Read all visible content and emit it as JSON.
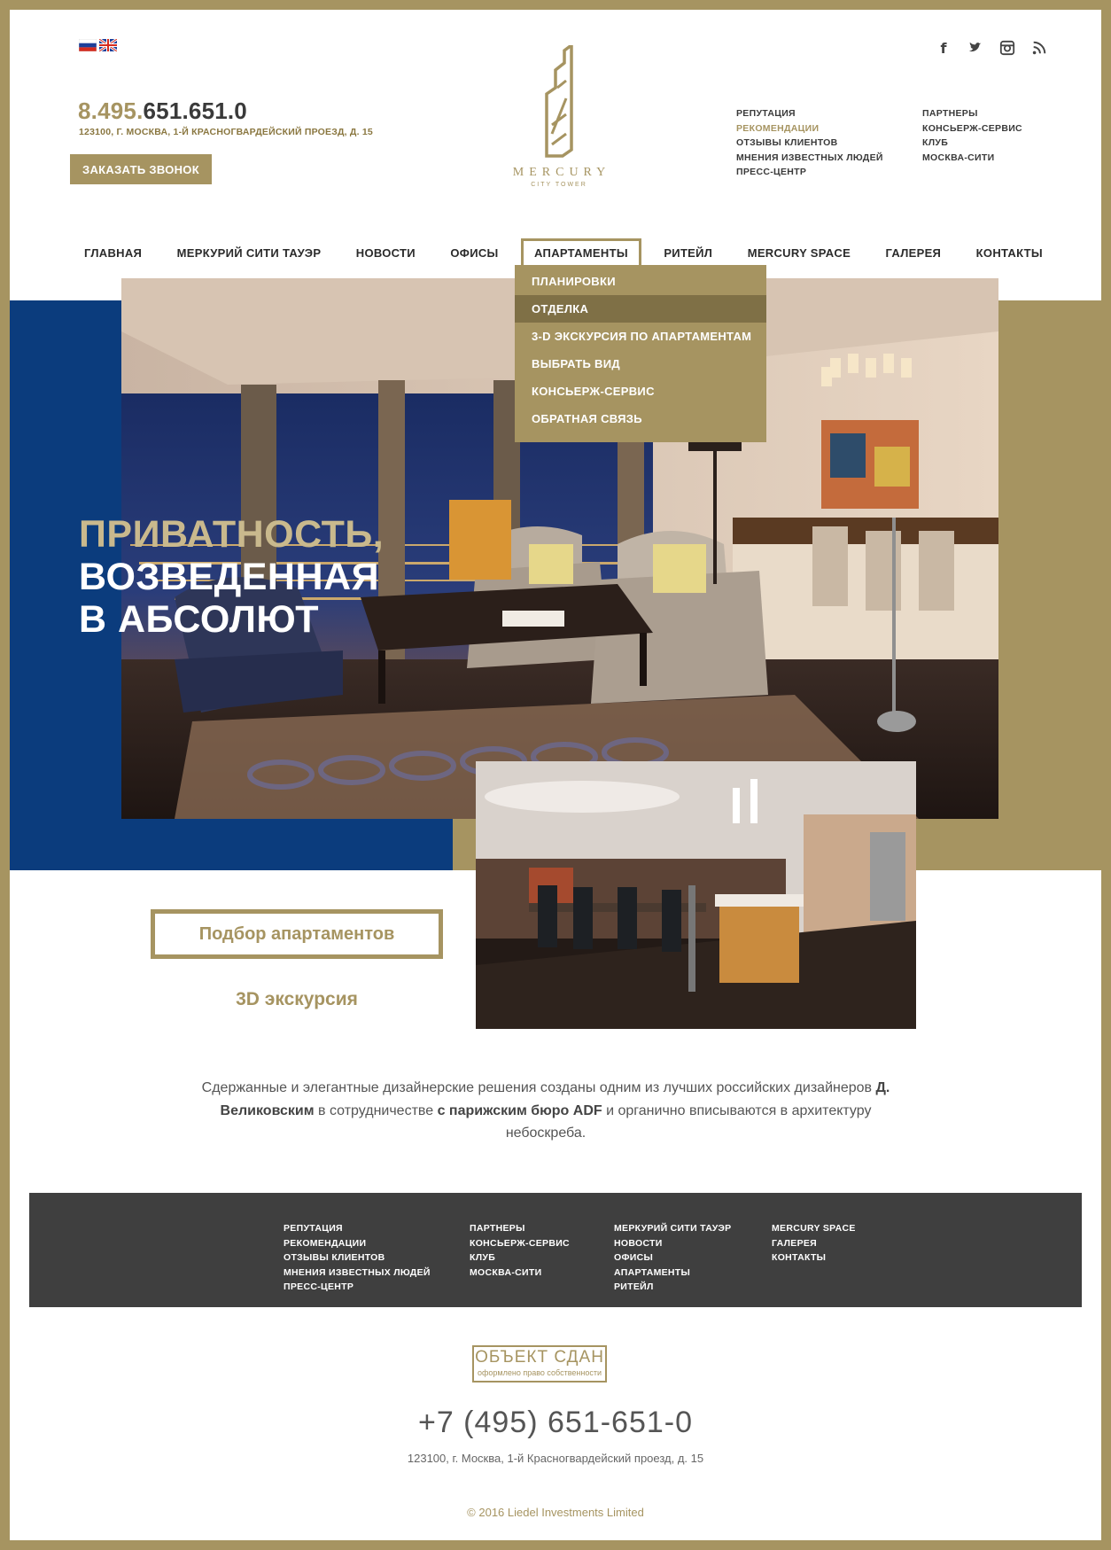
{
  "header": {
    "lang_flags": [
      "ru-flag-icon",
      "uk-flag-icon"
    ],
    "phone_prefix": "8.495.",
    "phone_rest": "651.651.0",
    "address": "123100, Г. МОСКВА, 1-Й КРАСНОГВАРДЕЙСКИЙ ПРОЕЗД, Д. 15",
    "callback_label": "ЗАКАЗАТЬ ЗВОНОК",
    "logo_word": "MERCURY",
    "logo_sub": "CITY TOWER",
    "social": [
      "facebook-icon",
      "twitter-icon",
      "instagram-icon",
      "rss-icon"
    ],
    "links_col1": [
      "РЕПУТАЦИЯ",
      "РЕКОМЕНДАЦИИ",
      "ОТЗЫВЫ КЛИЕНТОВ",
      "МНЕНИЯ ИЗВЕСТНЫХ ЛЮДЕЙ",
      "ПРЕСС-ЦЕНТР"
    ],
    "links_col2": [
      "ПАРТНЕРЫ",
      "КОНСЬЕРЖ-СЕРВИС",
      "КЛУБ",
      "МОСКВА-СИТИ"
    ]
  },
  "nav": {
    "items": [
      "ГЛАВНАЯ",
      "МЕРКУРИЙ СИТИ ТАУЭР",
      "НОВОСТИ",
      "ОФИСЫ",
      "АПАРТАМЕНТЫ",
      "РИТЕЙЛ",
      "MERCURY SPACE",
      "ГАЛЕРЕЯ",
      "КОНТАКТЫ"
    ],
    "active_index": 4
  },
  "dropdown": {
    "items": [
      "ПЛАНИРОВКИ",
      "ОТДЕЛКА",
      "3-D ЭКСКУРСИЯ ПО АПАРТАМЕНТАМ",
      "ВЫБРАТЬ ВИД",
      "КОНСЬЕРЖ-СЕРВИС",
      "ОБРАТНАЯ СВЯЗЬ"
    ],
    "active_index": 1
  },
  "hero": {
    "line1": "ПРИВАТНОСТЬ,",
    "line2": "ВОЗВЕДЕННАЯ",
    "line3": "В АБСОЛЮТ"
  },
  "main": {
    "select_button": "Подбор апартаментов",
    "tour_link": "3D экскурсия",
    "desc_1": "Сдержанные и элегантные дизайнерские решения созданы одним из лучших российских дизайнеров ",
    "desc_b1": "Д. Великовским",
    "desc_2": " в сотрудничестве ",
    "desc_b2": "с парижским бюро ADF",
    "desc_3": " и органично вписываются в архитектуру небоскреба."
  },
  "footer": {
    "col1": [
      "РЕПУТАЦИЯ",
      "РЕКОМЕНДАЦИИ",
      "ОТЗЫВЫ КЛИЕНТОВ",
      "МНЕНИЯ ИЗВЕСТНЫХ ЛЮДЕЙ",
      "ПРЕСС-ЦЕНТР"
    ],
    "col2": [
      "ПАРТНЕРЫ",
      "КОНСЬЕРЖ-СЕРВИС",
      "КЛУБ",
      "МОСКВА-СИТИ"
    ],
    "col3": [
      "МЕРКУРИЙ СИТИ ТАУЭР",
      "НОВОСТИ",
      "ОФИСЫ",
      "АПАРТАМЕНТЫ",
      "РИТЕЙЛ"
    ],
    "col4": [
      "MERCURY SPACE",
      "ГАЛЕРЕЯ",
      "КОНТАКТЫ"
    ],
    "stamp_title": "ОБЪЕКТ СДАН",
    "stamp_sub": "оформлено право собственности",
    "phone": "+7 (495) 651-651-0",
    "address": "123100, г. Москва, 1-й Красногвардейский проезд, д. 15",
    "copyright": "© 2016 Liedel Investments Limited"
  },
  "colors": {
    "gold": "#a69461",
    "blue": "#0b3c7d",
    "dark": "#3f3f3f"
  }
}
